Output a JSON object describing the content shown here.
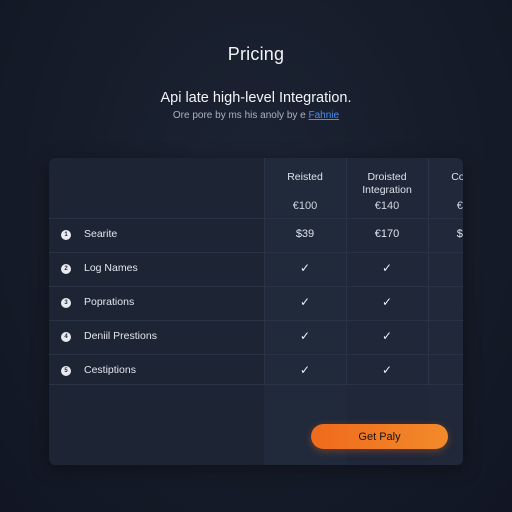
{
  "page": {
    "title": "Pricing",
    "headline": "Api late high-level Integration.",
    "subline_text": "Ore pore by ms his anoly by e",
    "subline_link": "Fahnie"
  },
  "plans": [
    {
      "name": "Reisted",
      "price": "€100"
    },
    {
      "name": "Droisted Integration",
      "price": "€140"
    },
    {
      "name": "Coltrvel",
      "price": "€180"
    }
  ],
  "rows": [
    {
      "bullet": "1",
      "label": "Searite",
      "values": [
        "$39",
        "€170",
        "$190"
      ]
    },
    {
      "bullet": "2",
      "label": "Log Names",
      "values": [
        "✓",
        "✓",
        "✓"
      ]
    },
    {
      "bullet": "3",
      "label": "Poprations",
      "values": [
        "✓",
        "✓",
        "✓"
      ]
    },
    {
      "bullet": "4",
      "label": "Deniil Prestions",
      "values": [
        "✓",
        "✓",
        "✓"
      ]
    },
    {
      "bullet": "5",
      "label": "Cestiptions",
      "values": [
        "✓",
        "✓",
        "✓"
      ]
    }
  ],
  "cta": {
    "label": "Get Paly"
  },
  "colors": {
    "background": "#151b28",
    "card": "#1d2433",
    "accent": "#f07a22",
    "link": "#4d8ef0"
  },
  "icons": {
    "check": "check-icon",
    "bullet": "circle-number-icon"
  }
}
